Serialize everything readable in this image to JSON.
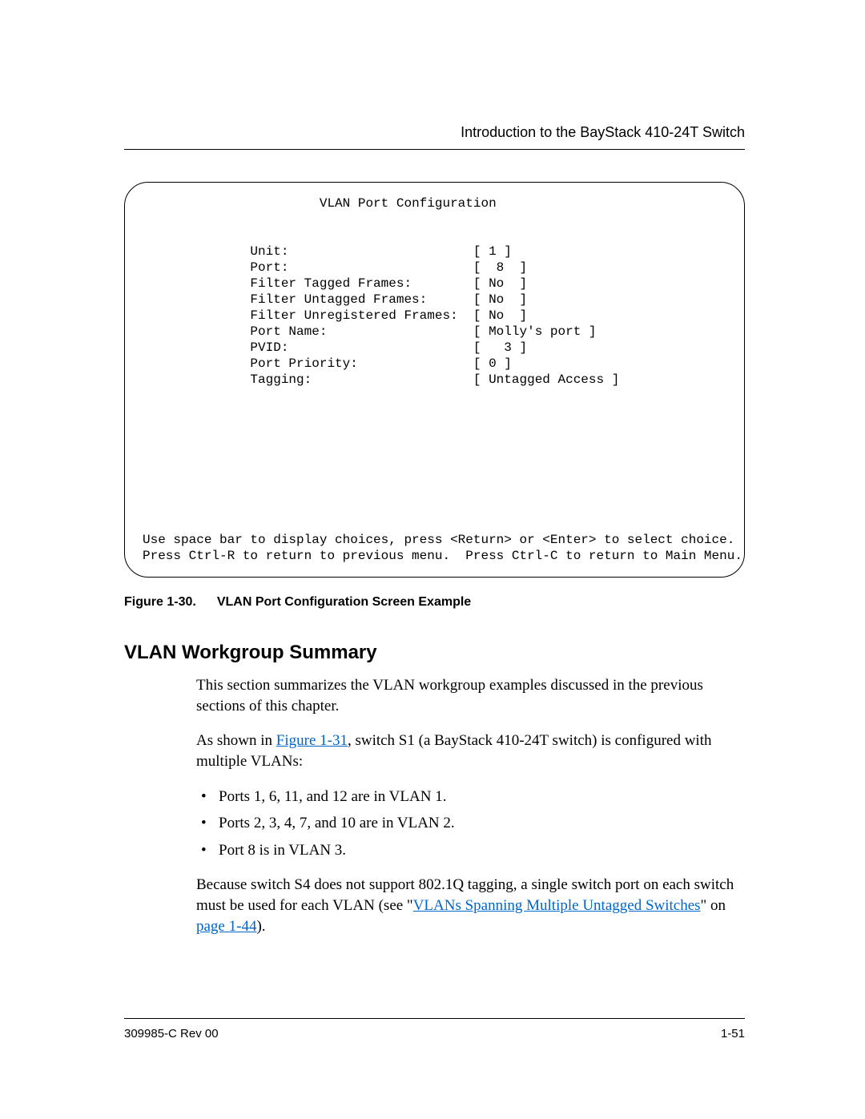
{
  "header": {
    "running_title": "Introduction to the BayStack 410-24T Switch"
  },
  "console": {
    "title": "VLAN Port Configuration",
    "labels": {
      "unit": "Unit:",
      "port": "Port:",
      "filter_tagged": "Filter Tagged Frames:",
      "filter_untagged": "Filter Untagged Frames:",
      "filter_unreg": "Filter Unregistered Frames:",
      "port_name": "Port Name:",
      "pvid": "PVID:",
      "port_priority": "Port Priority:",
      "tagging": "Tagging:"
    },
    "values": {
      "unit": "[ 1 ]",
      "port": "[  8  ]",
      "filter_tagged": "[ No  ]",
      "filter_untagged": "[ No  ]",
      "filter_unreg": "[ No  ]",
      "port_name": "[ Molly's port ]",
      "pvid": "[   3 ]",
      "port_priority": "[ 0 ]",
      "tagging": "[ Untagged Access ]"
    },
    "help1": "Use space bar to display choices, press <Return> or <Enter> to select choice.",
    "help2": "Press Ctrl-R to return to previous menu.  Press Ctrl-C to return to Main Menu."
  },
  "figure": {
    "label": "Figure 1-30.",
    "caption": "VLAN Port Configuration Screen Example"
  },
  "section": {
    "heading": "VLAN Workgroup Summary",
    "p1": "This section summarizes the VLAN workgroup examples discussed in the previous sections of this chapter.",
    "p2a": "As shown in ",
    "p2_link": "Figure 1-31",
    "p2b": ", switch S1 (a BayStack 410-24T switch) is configured with multiple VLANs:",
    "bullets": [
      "Ports 1, 6, 11, and 12 are in VLAN 1.",
      "Ports 2, 3, 4, 7, and 10 are in VLAN 2.",
      "Port 8 is in VLAN 3."
    ],
    "p3a": "Because switch S4 does not support 802.1Q tagging, a single switch port on each switch must be used for each VLAN (see \"",
    "p3_link1": "VLANs Spanning Multiple Untagged Switches",
    "p3b": "\" on ",
    "p3_link2": "page 1-44",
    "p3c": ")."
  },
  "footer": {
    "doc_id": "309985-C Rev 00",
    "page_num": "1-51"
  }
}
